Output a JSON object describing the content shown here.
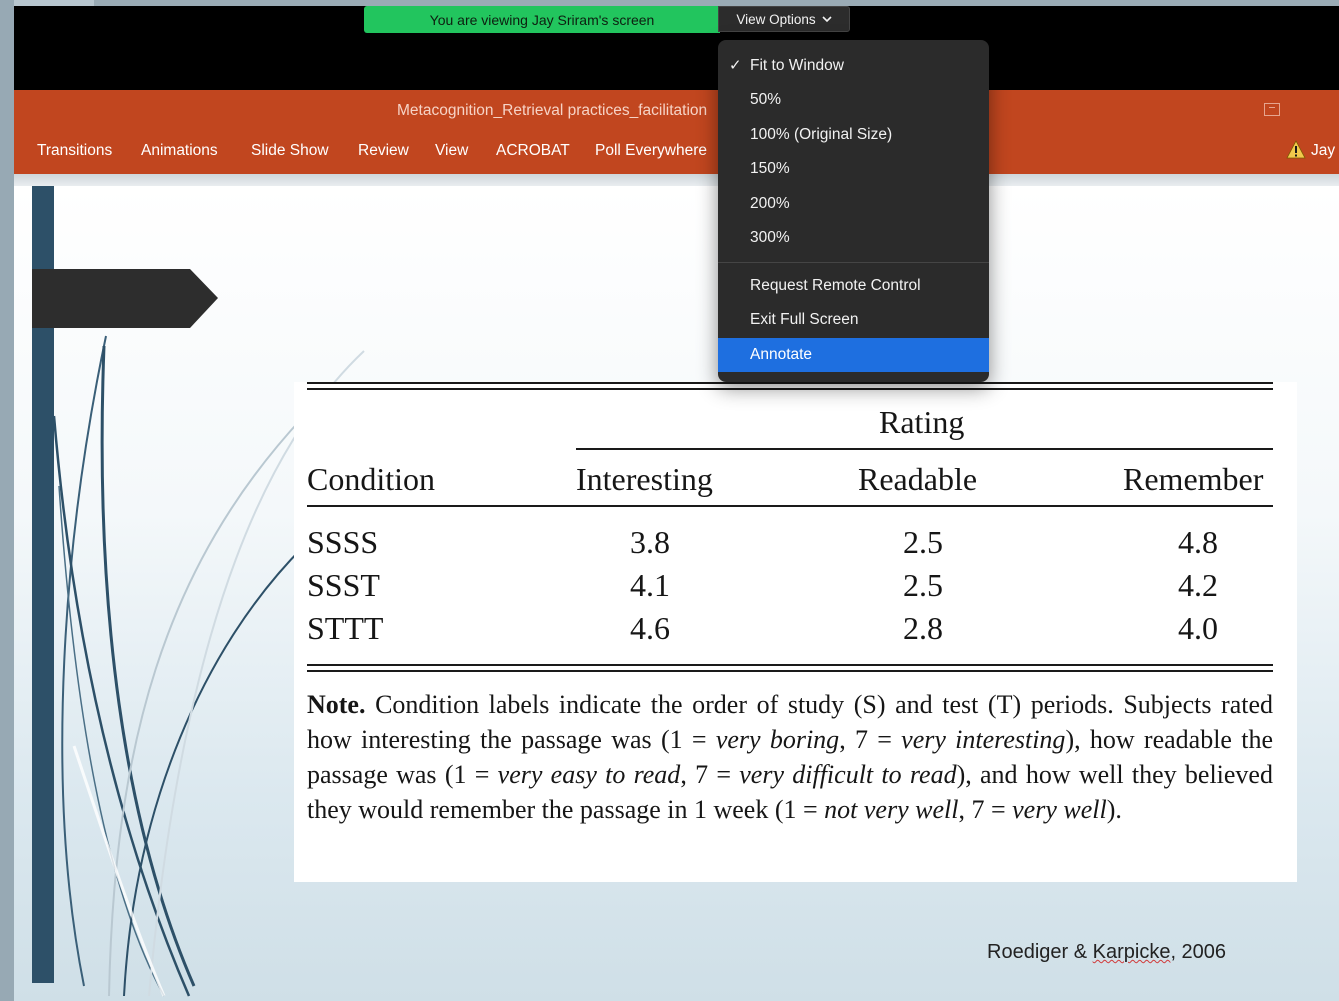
{
  "share_bar": {
    "banner": "You are viewing Jay Sriram's screen",
    "view_options_label": "View Options"
  },
  "view_menu": {
    "items": [
      {
        "label": "Fit to Window",
        "checked": true
      },
      {
        "label": "50%"
      },
      {
        "label": "100% (Original Size)"
      },
      {
        "label": "150%"
      },
      {
        "label": "200%"
      },
      {
        "label": "300%"
      },
      {
        "label": "Request Remote Control"
      },
      {
        "label": "Exit Full Screen"
      },
      {
        "label": "Annotate",
        "highlighted": true
      }
    ]
  },
  "powerpoint": {
    "doc_title": "Metacognition_Retrieval practices_facilitation",
    "tabs": [
      "Transitions",
      "Animations",
      "Slide Show",
      "Review",
      "View",
      "ACROBAT",
      "Poll Everywhere"
    ],
    "user": "Jay"
  },
  "slide": {
    "table": {
      "group_header": "Rating",
      "columns": [
        "Condition",
        "Interesting",
        "Readable",
        "Remember"
      ],
      "rows": [
        [
          "SSSS",
          "3.8",
          "2.5",
          "4.8"
        ],
        [
          "SSST",
          "4.1",
          "2.5",
          "4.2"
        ],
        [
          "STTT",
          "4.6",
          "2.8",
          "4.0"
        ]
      ],
      "note_label": "Note.",
      "note_parts": [
        " Condition labels indicate the order of study (S) and test (T) periods. Subjects rated how interesting the passage was (1 = ",
        "very boring",
        ", 7 = ",
        "very interesting",
        "), how readable the passage was (1 = ",
        "very easy to read",
        ", 7 = ",
        "very difficult to read",
        "), and how well they believed they would remember the passage in 1 week (1 = ",
        "not very well",
        ", 7 = ",
        "very well",
        ")."
      ]
    },
    "citation": {
      "author_a": "Roediger & ",
      "author_b": "Karpicke",
      "year": ", 2006"
    }
  },
  "colors": {
    "banner_green": "#22c55e",
    "ribbon_orange": "#c1461f",
    "menu_bg": "#2b2b2b",
    "menu_highlight": "#1e6fe0",
    "slide_bar": "#2d5068"
  }
}
